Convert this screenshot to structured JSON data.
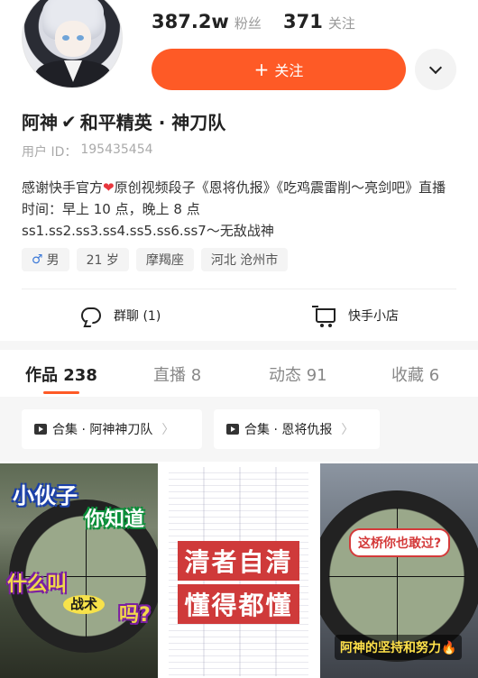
{
  "profile": {
    "fans_count": "387.2w",
    "fans_label": "粉丝",
    "following_count": "371",
    "following_label": "关注",
    "follow_button_label": "关注",
    "follow_button_icon": "+",
    "name": "阿神",
    "verified_icon": "✔",
    "name_suffix": "和平精英 · 神刀队",
    "uid_label": "用户 ID：",
    "uid_value": "195435454",
    "bio_line_1_a": "感谢快手官方",
    "bio_line_1_b": "原创视频段子《恩将仇报》《吃鸡震雷削～亮剑吧》直播时间：早上 10 点，晚上 8 点",
    "bio_line_2": "ss1.ss2.ss3.ss4.ss5.ss6.ss7～无敌战神",
    "tags": [
      {
        "icon": "♂",
        "text": "男"
      },
      {
        "text": "21 岁"
      },
      {
        "text": "摩羯座"
      },
      {
        "text": "河北 沧州市"
      }
    ]
  },
  "quick_actions": {
    "group_chat_label": "群聊 (1)",
    "shop_label": "快手小店"
  },
  "tabs": [
    {
      "label": "作品 238",
      "active": true
    },
    {
      "label": "直播 8",
      "active": false
    },
    {
      "label": "动态 91",
      "active": false
    },
    {
      "label": "收藏 6",
      "active": false
    }
  ],
  "collections": [
    {
      "label": "合集 · 阿神神刀队",
      "arrow": "〉"
    },
    {
      "label": "合集 · 恩将仇报",
      "arrow": "〉"
    }
  ],
  "videos": [
    {
      "captions": [
        "小伙子",
        "你知道",
        "什么叫",
        "战术",
        "吗?"
      ]
    },
    {
      "captions": [
        "清者自清",
        "懂得都懂"
      ]
    },
    {
      "captions": [
        "这桥你也敢过?",
        "阿神的坚持和努力🔥"
      ]
    }
  ],
  "colors": {
    "accent": "#fe5a26",
    "heart": "#e8363d",
    "male": "#3d7ad8"
  }
}
